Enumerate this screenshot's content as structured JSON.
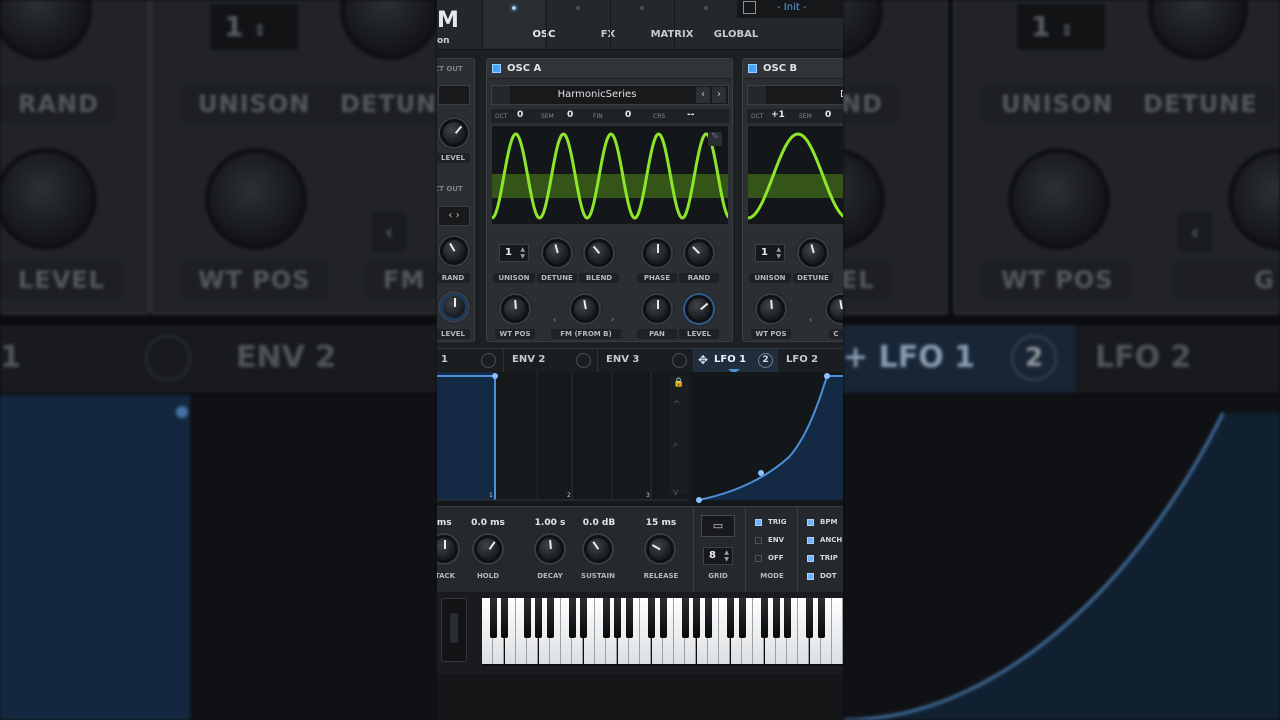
{
  "header": {
    "logo_letter": "M",
    "logo_sub": "on",
    "tabs": [
      {
        "label": "OSC",
        "active": true
      },
      {
        "label": "FX",
        "active": false
      },
      {
        "label": "MATRIX",
        "active": false
      },
      {
        "label": "GLOBAL",
        "active": false
      }
    ],
    "preset_name": "- Init -"
  },
  "left_strip": {
    "labels": [
      "CT OUT",
      "CT OUT"
    ],
    "knobs": [
      "LEVEL",
      "RAND",
      "LEVEL"
    ]
  },
  "osc_a": {
    "title": "OSC A",
    "wavetable": "HarmonicSeries",
    "pitch": [
      {
        "label": "OCT",
        "value": "0"
      },
      {
        "label": "SEM",
        "value": "0"
      },
      {
        "label": "FIN",
        "value": "0"
      },
      {
        "label": "CRS",
        "value": "--"
      }
    ],
    "unison_value": "1",
    "labels": {
      "unison": "UNISON",
      "detune": "DETUNE",
      "blend": "BLEND",
      "phase": "PHASE",
      "rand": "RAND",
      "wtpos": "WT POS",
      "fm": "FM (FROM B)",
      "pan": "PAN",
      "level": "LEVEL"
    },
    "wave_color": "#8ee62a"
  },
  "osc_b": {
    "title": "OSC B",
    "wavetable": "D",
    "pitch": [
      {
        "label": "OCT",
        "value": "+1"
      },
      {
        "label": "SEM",
        "value": "0"
      }
    ],
    "unison_value": "1",
    "labels": {
      "unison": "UNISON",
      "detune": "DETUNE",
      "wtpos": "WT POS",
      "cut": "C"
    }
  },
  "mod_tabs": {
    "env1_fragment": "1",
    "env2": "ENV 2",
    "env3": "ENV 3",
    "lfo1": "LFO 1",
    "lfo1_count": "2",
    "lfo2": "LFO 2"
  },
  "env_graph": {
    "markers": [
      "1",
      "2",
      "3"
    ],
    "accent": "#4d8fd8"
  },
  "env_params": [
    {
      "value": "s ms",
      "label": "TACK"
    },
    {
      "value": "0.0 ms",
      "label": "HOLD"
    },
    {
      "value": "1.00 s",
      "label": "DECAY"
    },
    {
      "value": "0.0 dB",
      "label": "SUSTAIN"
    },
    {
      "value": "15 ms",
      "label": "RELEASE"
    }
  ],
  "lfo_controls": {
    "grid_value": "8",
    "grid_label": "GRID",
    "mode_label": "MODE",
    "mode_options": [
      {
        "label": "TRIG",
        "on": true
      },
      {
        "label": "ENV",
        "on": false
      },
      {
        "label": "OFF",
        "on": false
      }
    ],
    "sync_options": [
      {
        "label": "BPM",
        "on": true
      },
      {
        "label": "ANCH",
        "on": true
      },
      {
        "label": "TRIP",
        "on": true
      },
      {
        "label": "DOT",
        "on": true
      }
    ]
  },
  "background": {
    "left": {
      "rand": "RAND",
      "unison": "UNISON",
      "detune": "DETUNE",
      "level": "LEVEL",
      "wtpos": "WT POS",
      "fm": "FM",
      "env2": "ENV 2",
      "one": "1",
      "unison_val": "1"
    },
    "right": {
      "unison": "UNISON",
      "detune": "DETUNE",
      "wtpos": "WT POS",
      "lfo1": "+ LFO 1",
      "lfo2": "LFO 2",
      "lfo_count": "2",
      "nd": "ND",
      "el": "EL",
      "g": "G",
      "unison_val": "1"
    }
  }
}
